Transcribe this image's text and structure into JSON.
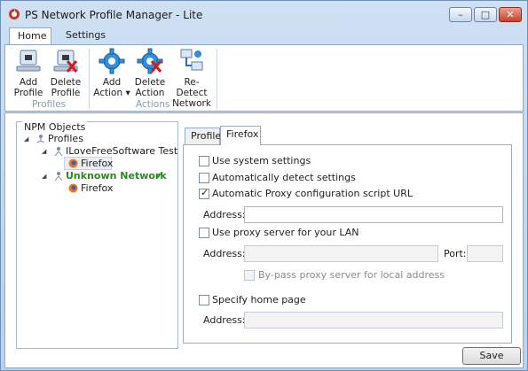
{
  "window": {
    "title": "PS Network Profile Manager - Lite",
    "controls": {
      "minimize": "–",
      "maximize": "□",
      "close": "✕"
    }
  },
  "ribbon": {
    "tabs": [
      {
        "label": "Home",
        "active": true
      },
      {
        "label": "Settings",
        "active": false
      }
    ],
    "buttons": {
      "add_profile": [
        "Add",
        "Profile"
      ],
      "delete_profile": [
        "Delete",
        "Profile"
      ],
      "add_action": [
        "Add",
        "Action ▾"
      ],
      "delete_action": [
        "Delete",
        "Action"
      ],
      "redetect": [
        "Re-Detect",
        "Network"
      ]
    },
    "groups": {
      "profiles": "Profiles",
      "actions": "Actions"
    }
  },
  "tree": {
    "header": "NPM Objects",
    "root": "Profiles",
    "profiles": [
      {
        "name": "ILoveFreeSoftware Test",
        "child": "Firefox",
        "active": false
      },
      {
        "name": "Unknown Network",
        "child": "Firefox",
        "active": true,
        "check": "✔"
      }
    ]
  },
  "detail_tabs": [
    {
      "label": "Profile",
      "active": false
    },
    {
      "label": "Firefox",
      "active": true
    }
  ],
  "firefox": {
    "use_system": {
      "label": "Use system settings",
      "checked": false
    },
    "auto_detect": {
      "label": "Automatically detect settings",
      "checked": false
    },
    "auto_proxy": {
      "label": "Automatic Proxy configuration script URL",
      "checked": true
    },
    "auto_proxy_address_label": "Address:",
    "auto_proxy_address": "",
    "use_proxy": {
      "label": "Use proxy server for your LAN",
      "checked": false
    },
    "proxy_address_label": "Address:",
    "proxy_address": "",
    "port_label": "Port:",
    "port": "",
    "bypass": {
      "label": "By-pass proxy server for local address",
      "checked": false
    },
    "home_page": {
      "label": "Specify home page",
      "checked": false
    },
    "home_address_label": "Address:",
    "home_address": ""
  },
  "footer": {
    "save": "Save"
  },
  "colors": {
    "accent": "#1f6fbf",
    "active_profile": "#2a8a1e",
    "ribbon_border": "#8fa9cc"
  }
}
